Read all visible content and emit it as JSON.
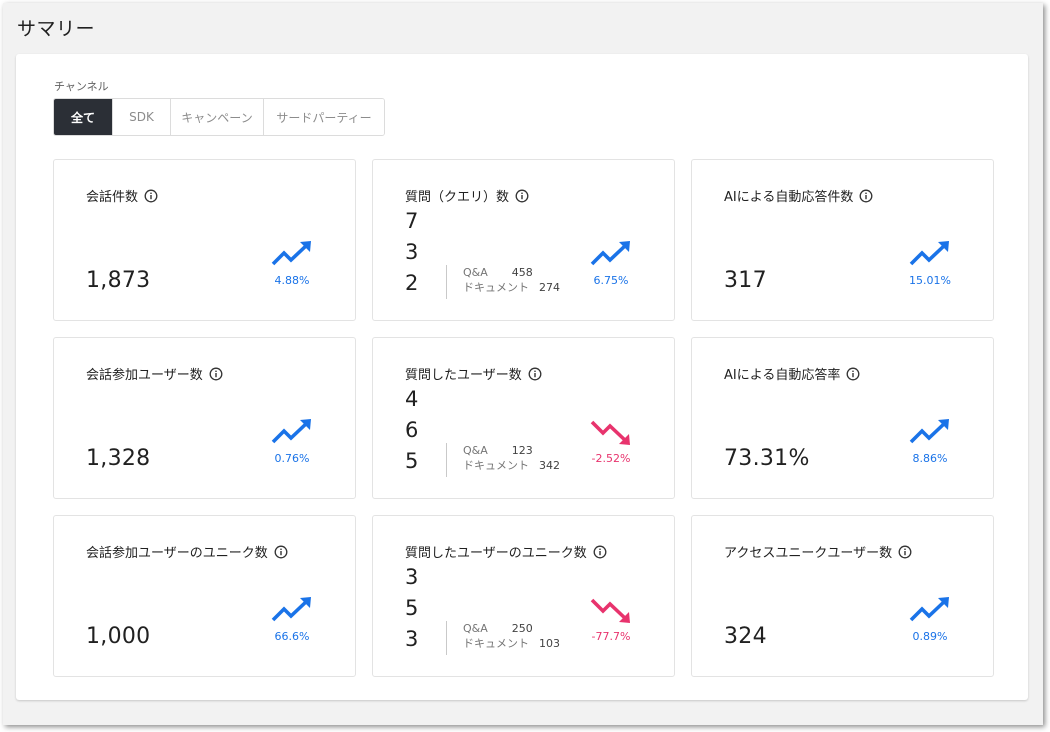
{
  "page": {
    "title": "サマリー"
  },
  "filter": {
    "label": "チャンネル",
    "options": [
      "全て",
      "SDK",
      "キャンペーン",
      "サードパーティー"
    ],
    "selected": "全て"
  },
  "colors": {
    "up": "#1a73e8",
    "down": "#e8336d",
    "active_tab": "#2b2f36"
  },
  "cards": [
    {
      "title": "会話件数",
      "value": "1,873",
      "trend": "up",
      "change": "4.88%"
    },
    {
      "title": "質問（クエリ）数",
      "value": "732",
      "trend": "up",
      "change": "6.75%",
      "breakdown": {
        "qa_label": "Q&A",
        "qa_value": "458",
        "doc_label": "ドキュメント",
        "doc_value": "274"
      }
    },
    {
      "title": "AIによる自動応答件数",
      "value": "317",
      "trend": "up",
      "change": "15.01%"
    },
    {
      "title": "会話参加ユーザー数",
      "value": "1,328",
      "trend": "up",
      "change": "0.76%"
    },
    {
      "title": "質問したユーザー数",
      "value": "465",
      "trend": "down",
      "change": "-2.52%",
      "breakdown": {
        "qa_label": "Q&A",
        "qa_value": "123",
        "doc_label": "ドキュメント",
        "doc_value": "342"
      }
    },
    {
      "title": "AIによる自動応答率",
      "value": "73.31%",
      "trend": "up",
      "change": "8.86%"
    },
    {
      "title": "会話参加ユーザーのユニーク数",
      "value": "1,000",
      "trend": "up",
      "change": "66.6%"
    },
    {
      "title": "質問したユーザーのユニーク数",
      "value": "353",
      "trend": "down",
      "change": "-77.7%",
      "breakdown": {
        "qa_label": "Q&A",
        "qa_value": "250",
        "doc_label": "ドキュメント",
        "doc_value": "103"
      }
    },
    {
      "title": "アクセスユニークユーザー数",
      "value": "324",
      "trend": "up",
      "change": "0.89%"
    }
  ],
  "icons": {
    "info": "info-circle-icon",
    "up": "trending-up-icon",
    "down": "trending-down-icon"
  }
}
